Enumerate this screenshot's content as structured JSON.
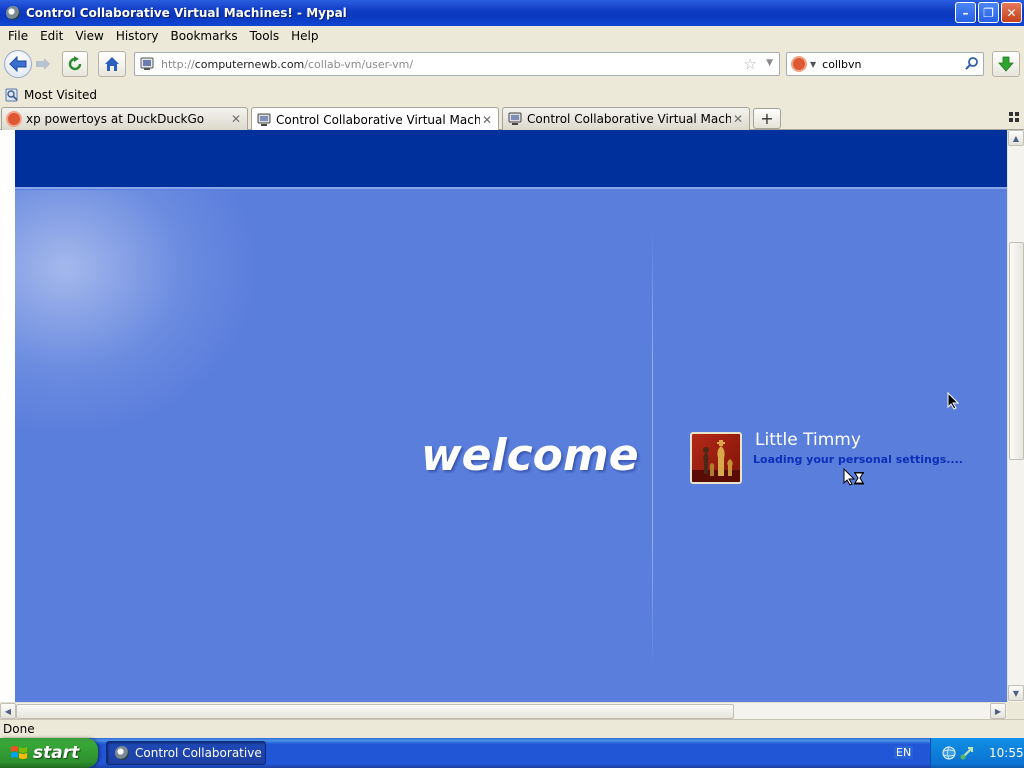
{
  "window": {
    "title": "Control Collaborative Virtual Machines! - Mypal",
    "minimize_glyph": "–",
    "maximize_glyph": "❐",
    "close_glyph": "✕"
  },
  "menu": [
    "File",
    "Edit",
    "View",
    "History",
    "Bookmarks",
    "Tools",
    "Help"
  ],
  "navbar": {
    "url_prefix": "http://",
    "url_host": "computernewb.com",
    "url_path": "/collab-vm/user-vm/",
    "search_value": "collbvn"
  },
  "bookmarks": {
    "most_visited": "Most Visited"
  },
  "tabs": [
    {
      "label": "xp powertoys at DuckDuckGo",
      "active": false
    },
    {
      "label": "Control Collaborative Virtual Machines!",
      "active": true
    },
    {
      "label": "Control Collaborative Virtual Machines!",
      "active": false
    }
  ],
  "newtab_glyph": "+",
  "vm": {
    "welcome": "welcome",
    "user_name": "Little Timmy",
    "loading": "Loading your personal settings....",
    "colors": {
      "background": "#5a7edc",
      "top_band": "#00309c"
    }
  },
  "status": {
    "text": "Done"
  },
  "taskbar": {
    "start_label": "start",
    "task_label": "Control Collaborative ...",
    "language": "EN",
    "clock": "10:55"
  }
}
